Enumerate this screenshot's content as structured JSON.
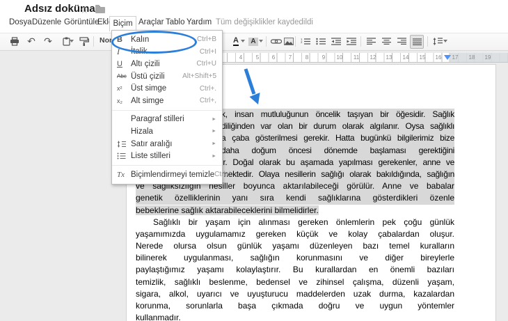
{
  "colors": {
    "annotation_blue": "#2b7fd9",
    "selection_gray": "#d8d8d8",
    "canvas_gray": "#ebebeb"
  },
  "header": {
    "title": "Adsız doküman",
    "status": "Tüm değişiklikler kaydedildi"
  },
  "menu_bar": {
    "items": [
      "Dosya",
      "Düzenle",
      "Görüntüle",
      "Ekle",
      "Biçim",
      "Araçlar",
      "Tablo",
      "Yardım"
    ],
    "active_item": "Biçim"
  },
  "toolbar": {
    "styles_value": "Normal m...",
    "icons": {
      "undo": "↶",
      "redo": "↷",
      "text_color": "A",
      "highlight": "A"
    }
  },
  "format_menu": {
    "submenu_arrow": "►",
    "items": [
      {
        "icon": "bold-icon",
        "glyph": "B",
        "label": "Kalın",
        "shortcut": "Ctrl+B"
      },
      {
        "icon": "italic-icon",
        "glyph": "I",
        "label": "İtalik",
        "shortcut": "Ctrl+I"
      },
      {
        "icon": "underline-icon",
        "glyph": "U",
        "label": "Altı çizili",
        "shortcut": "Ctrl+U"
      },
      {
        "icon": "strikethrough-icon",
        "glyph": "Abc",
        "label": "Üstü çizili",
        "shortcut": "Alt+Shift+5"
      },
      {
        "icon": "superscript-icon",
        "glyph": "x²",
        "label": "Üst simge",
        "shortcut": "Ctrl+."
      },
      {
        "icon": "subscript-icon",
        "glyph": "x₂",
        "label": "Alt simge",
        "shortcut": "Ctrl+,"
      },
      {
        "label": "Paragraf stilleri",
        "submenu": true
      },
      {
        "label": "Hizala",
        "submenu": true
      },
      {
        "icon": "line-spacing-icon",
        "label": "Satır aralığı",
        "submenu": true
      },
      {
        "icon": "list-styles-icon",
        "label": "Liste stilleri",
        "submenu": true
      },
      {
        "icon": "clear-formatting-icon",
        "glyph": "Tx",
        "label": "Biçimlendirmeyi temizle",
        "shortcut": "Ctrl+\\"
      }
    ]
  },
  "ruler": {
    "numbers": [
      "4",
      "5",
      "6",
      "7",
      "8",
      "9",
      "10",
      "11",
      "12",
      "13",
      "14",
      "15",
      "16",
      "17",
      "18",
      "19"
    ]
  },
  "document": {
    "lines": [
      {
        "text": "k, insan mutluluğunun öncelik taşıyan bir öğesidir. Sağlık"
      },
      {
        "text": "diliğinden var olan bir durum olarak algılanır. Oysa sağlıklı"
      },
      {
        "text": "a çaba gösterilmesi gerekir. Hatta bugünkü bilgilerimiz bize"
      },
      {
        "text": "daha doğum öncesi dönemde başlaması gerektiğini"
      },
      {
        "text": "ir. Doğal olarak bu aşamada yapılması gerekenler, anne ve"
      },
      {
        "text": "mektedir. Olaya nesillerin sağlığı olarak bakıldığında, sağlığın"
      },
      {
        "text": "ve sağlıksızlığın nesiller boyunca aktarılabileceği görülür. Anne ve babalar"
      },
      {
        "text": "genetik özelliklerinin yanı sıra kendi sağlıklarına gösterdikleri özenle"
      },
      {
        "text": "bebeklerine sağlık aktarabileceklerini bilmelidirler."
      },
      {
        "text": "Sağlıklı bir yaşam için alınması gereken önlemlerin pek çoğu günlük"
      },
      {
        "text": "yaşamımızda  uygulamamız gereken küçük ve kolay çabalardan oluşur."
      },
      {
        "text": "Nerede olursa olsun günlük yaşamı düzenleyen bazı temel kuralların"
      },
      {
        "text": "bilinerek uygulanması, sağlığın korunmasını ve diğer bireylerle"
      },
      {
        "text": "paylaştığımız yaşamı kolaylaştırır. Bu kurallardan en önemli bazıları"
      },
      {
        "text": "temizlik, sağlıklı beslenme, bedensel ve zihinsel çalışma, düzenli yaşam,"
      },
      {
        "text": "sigara, alkol, uyarıcı ve uyuşturucu maddelerden uzak durma, kazalardan"
      },
      {
        "text": "korunma, sorunlarla başa çıkmada doğru ve uygun yöntemler"
      },
      {
        "text": "kullanmadır."
      }
    ]
  }
}
